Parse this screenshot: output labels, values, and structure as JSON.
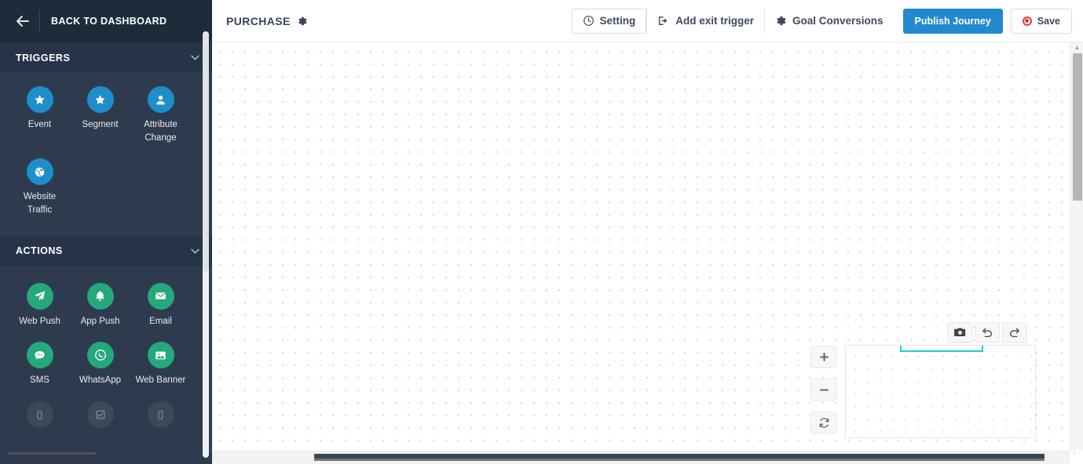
{
  "sidebar": {
    "back": {
      "label": "BACK TO DASHBOARD",
      "icon": "arrow-left-icon"
    },
    "sections": [
      {
        "key": "triggers",
        "title": "TRIGGERS",
        "chevron": "⌄",
        "items": [
          {
            "label": "Event",
            "icon": "star-icon",
            "color": "#1d8ec9",
            "state": "enabled"
          },
          {
            "label": "Segment",
            "icon": "star-icon",
            "color": "#1d8ec9",
            "state": "enabled"
          },
          {
            "label": "Attribute\nChange",
            "icon": "user-icon",
            "color": "#1d8ec9",
            "state": "enabled"
          },
          {
            "label": "Website\nTraffic",
            "icon": "globe-icon",
            "color": "#1d8ec9",
            "state": "enabled"
          }
        ]
      },
      {
        "key": "actions",
        "title": "ACTIONS",
        "chevron": "⌄",
        "items": [
          {
            "label": "Web Push",
            "icon": "paper-plane-icon",
            "color": "#24a87c",
            "state": "enabled"
          },
          {
            "label": "App Push",
            "icon": "bell-icon",
            "color": "#24a87c",
            "state": "enabled"
          },
          {
            "label": "Email",
            "icon": "envelope-icon",
            "color": "#24a87c",
            "state": "enabled"
          },
          {
            "label": "SMS",
            "icon": "chat-bubble-icon",
            "color": "#24a87c",
            "state": "enabled"
          },
          {
            "label": "WhatsApp",
            "icon": "whatsapp-icon",
            "color": "#24a87c",
            "state": "enabled"
          },
          {
            "label": "Web Banner",
            "icon": "image-icon",
            "color": "#24a87c",
            "state": "enabled"
          },
          {
            "label": "",
            "icon": "mobile-icon",
            "color": "#3c4959",
            "state": "disabled"
          },
          {
            "label": "",
            "icon": "survey-icon",
            "color": "#3c4959",
            "state": "disabled"
          },
          {
            "label": "",
            "icon": "mobile-icon",
            "color": "#3c4959",
            "state": "disabled"
          }
        ]
      }
    ]
  },
  "topbar": {
    "journey_title": "PURCHASE",
    "title_gear_icon": "gear-icon",
    "buttons": [
      {
        "key": "setting",
        "label": "Setting",
        "icon": "clock-icon",
        "style": "outline"
      },
      {
        "key": "add_exit_trigger",
        "label": "Add exit trigger",
        "icon": "exit-icon",
        "style": "plain"
      },
      {
        "key": "goal_conversions",
        "label": "Goal Conversions",
        "icon": "gear-icon",
        "style": "plain"
      },
      {
        "key": "publish_journey",
        "label": "Publish Journey",
        "icon": "",
        "style": "primary"
      },
      {
        "key": "save",
        "label": "Save",
        "icon": "record-icon",
        "style": "save"
      }
    ]
  },
  "canvas": {
    "minimap": {
      "name": "journey-minimap",
      "viewport_color": "#1fd1c6"
    },
    "mini_tools": [
      {
        "key": "screenshot",
        "icon": "camera-icon",
        "title": "Screenshot"
      },
      {
        "key": "undo",
        "icon": "undo-icon",
        "title": "Undo"
      },
      {
        "key": "redo",
        "icon": "redo-icon",
        "title": "Redo"
      }
    ],
    "zoom_tools": [
      {
        "key": "zoom-in",
        "icon": "plus-icon",
        "glyph": "+"
      },
      {
        "key": "zoom-out",
        "icon": "minus-icon",
        "glyph": "−"
      },
      {
        "key": "zoom-reset",
        "icon": "refresh-icon",
        "glyph": ""
      }
    ]
  },
  "colors": {
    "sidebar_bg": "#2e3b4e",
    "sidebar_head_bg": "#1d2b3a",
    "section_bar_bg": "#26344a",
    "trigger_accent": "#1d8ec9",
    "action_accent": "#24a87c",
    "primary_button": "#2389ce",
    "record_red": "#e23c3c",
    "viewport_cyan": "#1fd1c6"
  }
}
